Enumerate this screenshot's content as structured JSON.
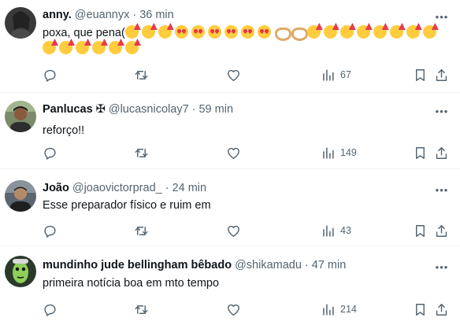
{
  "tweets": [
    {
      "name": "anny.",
      "handle": "@euannyx",
      "dot": "·",
      "time": "36 min",
      "text": "poxa, que pena(",
      "emojis": [
        "party",
        "party",
        "party",
        "heart",
        "heart",
        "heart",
        "heart",
        "heart",
        "heart",
        "hands",
        "hands",
        "party",
        "party",
        "party",
        "party",
        "party",
        "party",
        "party",
        "party",
        "party",
        "party",
        "party",
        "party",
        "party",
        "party"
      ],
      "views": "67"
    },
    {
      "name": "Panlucas ✠",
      "handle": "@lucasnicolay7",
      "dot": "·",
      "time": "59 min",
      "text": "reforço!!",
      "views": "149"
    },
    {
      "name": "João",
      "handle": "@joaovictorprad_",
      "dot": "·",
      "time": "24 min",
      "text": "Esse preparador físico e ruim em",
      "views": "43"
    },
    {
      "name": "mundinho jude bellingham bêbado",
      "handle": "@shikamadu",
      "dot": "·",
      "time": "47 min",
      "text": "primeira notícia boa em mto tempo",
      "views": "214"
    }
  ],
  "icons": {
    "more": "more-horizontal-icon",
    "reply": "reply-icon",
    "retweet": "retweet-icon",
    "like": "heart-icon",
    "views": "views-chart-icon",
    "bookmark": "bookmark-icon",
    "share": "share-icon"
  },
  "colors": {
    "text": "#0f1419",
    "secondary": "#536471",
    "divider": "#eff3f4"
  }
}
